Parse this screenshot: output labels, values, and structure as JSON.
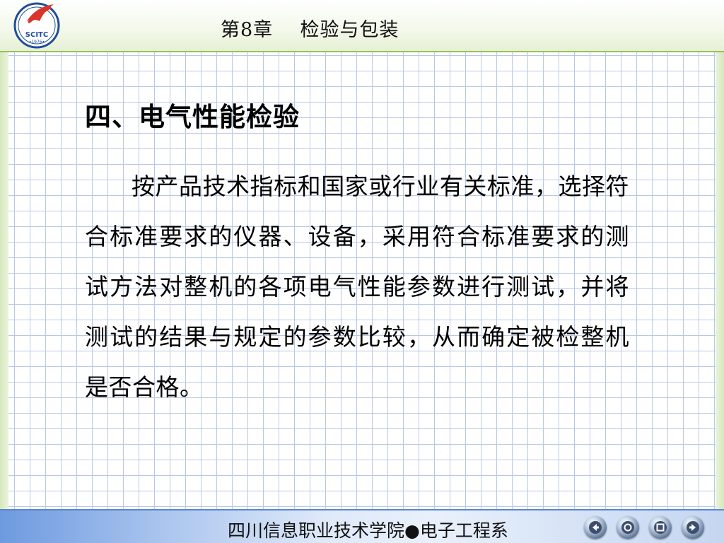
{
  "header": {
    "chapter_title": "第8章    检验与包装",
    "logo_text": "SCITC",
    "logo_year": "•1976•"
  },
  "content": {
    "section_title": "四、电气性能检验",
    "paragraph": "按产品技术指标和国家或行业有关标准，选择符合标准要求的仪器、设备，采用符合标准要求的测试方法对整机的各项电气性能参数进行测试，并将测试的结果与规定的参数比较，从而确定被检整机是否合格。"
  },
  "footer": {
    "institution": "四川信息职业技术学院●电子工程系"
  },
  "nav_buttons": [
    "back-icon",
    "home-icon",
    "menu-icon",
    "forward-icon"
  ],
  "colors": {
    "header_accent": "#9cbf5a",
    "grid_line": "#b9c8e6",
    "footer_blue": "#6d9adf",
    "logo_red": "#d9342b",
    "logo_blue": "#1f4e9a"
  }
}
